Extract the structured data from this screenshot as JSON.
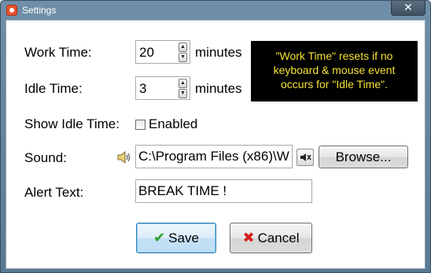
{
  "window": {
    "title": "Settings",
    "close_label": "✕"
  },
  "form": {
    "work_time_label": "Work Time:",
    "work_time_value": "20",
    "work_time_unit": "minutes",
    "idle_time_label": "Idle Time:",
    "idle_time_value": "3",
    "idle_time_unit": "minutes",
    "show_idle_label": "Show Idle Time:",
    "show_idle_checkbox_label": "Enabled",
    "show_idle_checked": false,
    "sound_label": "Sound:",
    "sound_path": "C:\\Program Files (x86)\\W",
    "browse_label": "Browse...",
    "alert_text_label": "Alert Text:",
    "alert_text_value": "BREAK TIME !"
  },
  "tooltip": {
    "lines": [
      "\"Work Time\" resets if no",
      "keyboard & mouse event",
      "occurs for \"Idle Time\"."
    ]
  },
  "buttons": {
    "save_label": "Save",
    "cancel_label": "Cancel"
  },
  "icons": {
    "app": "app-icon",
    "speaker": "speaker-icon",
    "mute": "mute-icon",
    "save": "checkmark-icon",
    "cancel": "x-icon"
  },
  "colors": {
    "tooltip_bg": "#000000",
    "tooltip_text": "#f5e232",
    "save_check": "#2aa12a",
    "cancel_x": "#d42020",
    "titlebar": "#6f8fa8"
  }
}
